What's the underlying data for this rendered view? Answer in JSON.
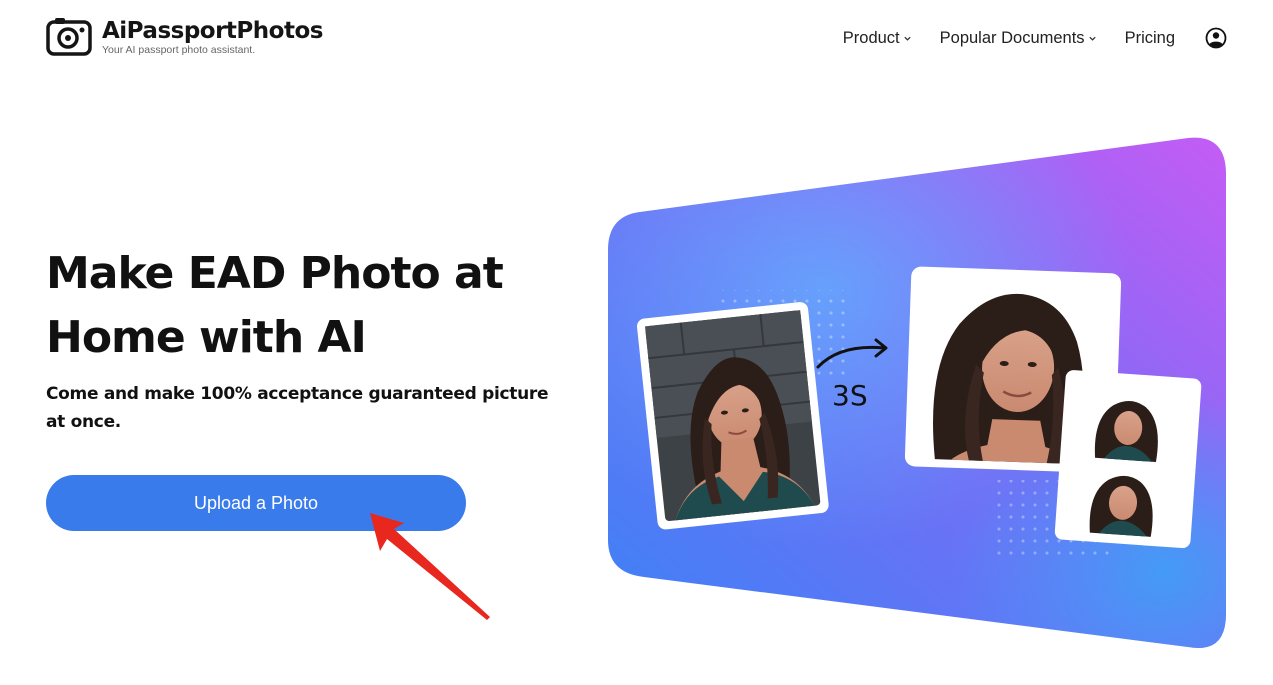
{
  "brand": {
    "name": "AiPassportPhotos",
    "tagline": "Your AI passport photo assistant."
  },
  "nav": {
    "items": [
      {
        "label": "Product",
        "has_dropdown": true
      },
      {
        "label": "Popular Documents",
        "has_dropdown": true
      },
      {
        "label": "Pricing",
        "has_dropdown": false
      }
    ],
    "account_icon": "user-circle-icon"
  },
  "hero": {
    "title_line1": "Make EAD Photo at",
    "title_line2": "Home with AI",
    "subtitle": "Come and make 100% acceptance guaranteed picture at once.",
    "cta_label": "Upload a Photo",
    "process_time": "3S"
  },
  "colors": {
    "primary_button": "#3a7bec",
    "annotation_arrow": "#e8281e",
    "gradient_start": "#3b82f6",
    "gradient_end": "#c45cf5"
  }
}
